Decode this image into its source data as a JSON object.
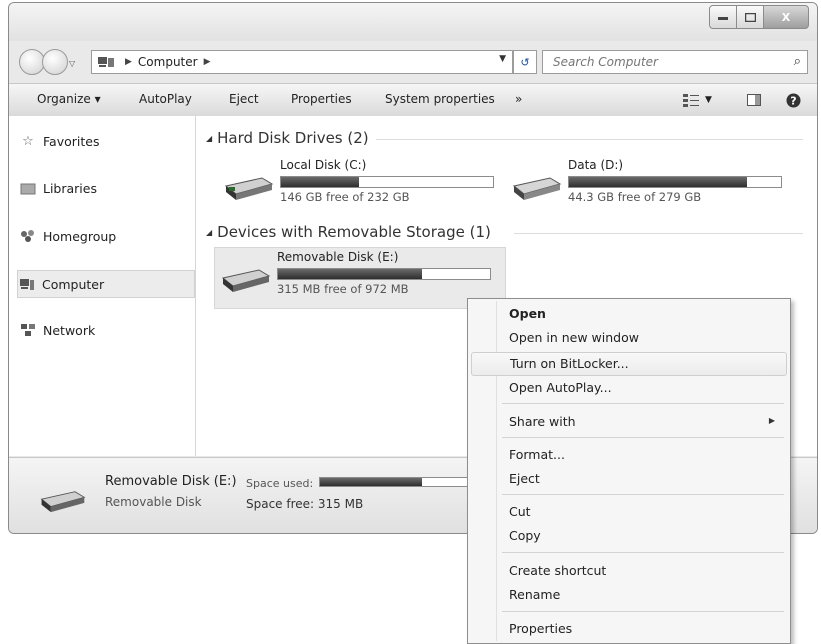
{
  "window": {
    "minimize_icon": "minimize-icon",
    "maximize_icon": "maximize-icon",
    "close_label": "X"
  },
  "nav": {
    "address_root": "Computer",
    "search_placeholder": "Search Computer"
  },
  "toolbar": {
    "organize": "Organize",
    "autoplay": "AutoPlay",
    "eject": "Eject",
    "properties": "Properties",
    "system_properties": "System properties",
    "more": "»"
  },
  "sidebar": {
    "items": [
      {
        "label": "Favorites",
        "icon": "star-icon"
      },
      {
        "label": "Libraries",
        "icon": "library-icon"
      },
      {
        "label": "Homegroup",
        "icon": "homegroup-icon"
      },
      {
        "label": "Computer",
        "icon": "computer-icon",
        "selected": true
      },
      {
        "label": "Network",
        "icon": "network-icon"
      }
    ]
  },
  "groups": {
    "hard_disks": {
      "title": "Hard Disk Drives (2)",
      "drives": [
        {
          "name": "Local Disk (C:)",
          "free": "146 GB free of 232 GB",
          "used_fraction": 0.37
        },
        {
          "name": "Data (D:)",
          "free": "44.3 GB free of 279 GB",
          "used_fraction": 0.84
        }
      ]
    },
    "removable": {
      "title": "Devices with Removable Storage (1)",
      "drives": [
        {
          "name": "Removable Disk (E:)",
          "free": "315 MB free of 972 MB",
          "used_fraction": 0.68
        }
      ]
    }
  },
  "details": {
    "name": "Removable Disk (E:)",
    "type": "Removable Disk",
    "space_used_label": "Space used:",
    "space_free": "Space free: 315 MB",
    "used_fraction": 0.68
  },
  "context_menu": {
    "open": "Open",
    "open_new_window": "Open in new window",
    "bitlocker": "Turn on BitLocker...",
    "open_autoplay": "Open AutoPlay...",
    "share_with": "Share with",
    "format": "Format...",
    "eject": "Eject",
    "cut": "Cut",
    "copy": "Copy",
    "create_shortcut": "Create shortcut",
    "rename": "Rename",
    "properties": "Properties"
  }
}
